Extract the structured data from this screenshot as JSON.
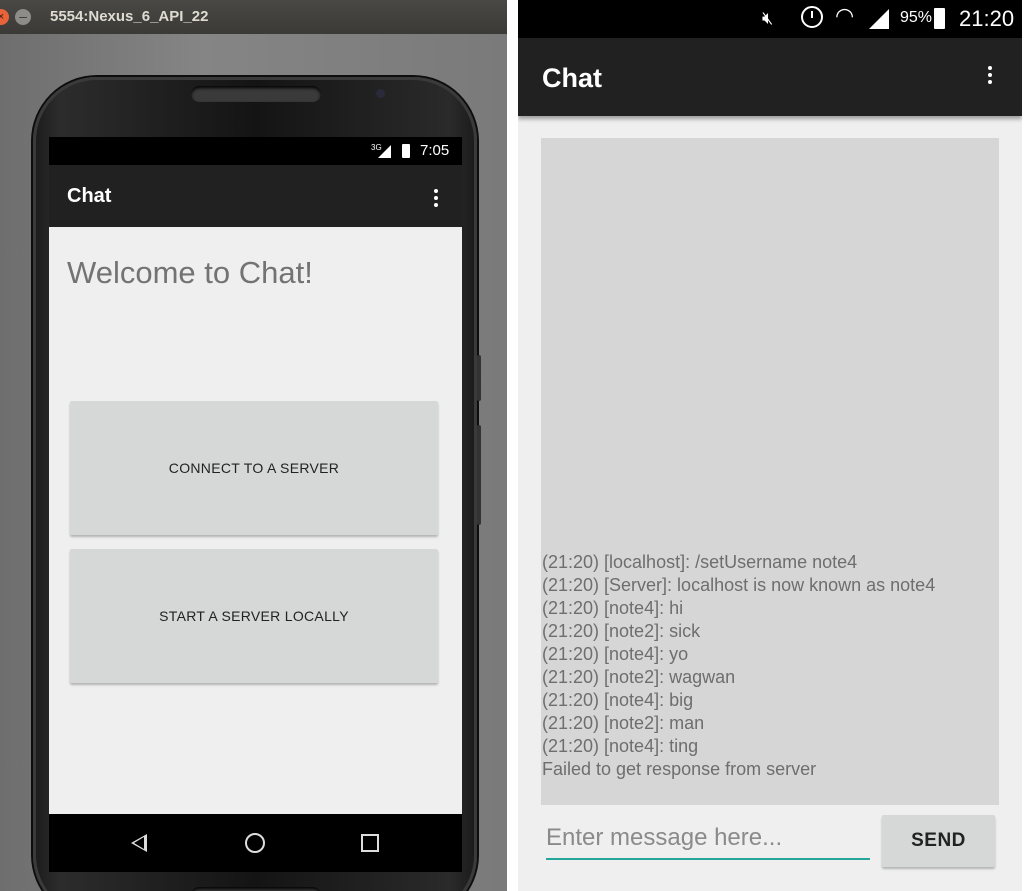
{
  "emulator": {
    "window_title": "5554:Nexus_6_API_22",
    "close_glyph": "×",
    "minimize_glyph": "–",
    "phone": {
      "status_bar": {
        "network": "3G",
        "time": "7:05"
      },
      "app_bar": {
        "title": "Chat",
        "menu_icon": "overflow-menu-icon"
      },
      "welcome_text": "Welcome to Chat!",
      "buttons": {
        "connect": "CONNECT TO A SERVER",
        "start_server": "START A SERVER LOCALLY"
      },
      "nav_bar": {
        "icons": [
          "back-icon",
          "home-icon",
          "recents-icon"
        ]
      }
    }
  },
  "device": {
    "status_bar": {
      "battery_percent": "95%",
      "time": "21:20",
      "icons": [
        "mute-icon",
        "alarm-icon",
        "wifi-icon",
        "signal-icon",
        "battery-icon"
      ]
    },
    "app_bar": {
      "title": "Chat",
      "menu_icon": "overflow-menu-icon"
    },
    "messages": [
      "(21:20) [localhost]: /setUsername note4",
      "(21:20) [Server]: localhost is now known as note4",
      "(21:20) [note4]: hi",
      "(21:20) [note2]: sick",
      "(21:20) [note4]: yo",
      "(21:20) [note2]: wagwan",
      "(21:20) [note4]: big",
      "(21:20) [note2]: man",
      "(21:20) [note4]: ting",
      "Failed to get response from server"
    ],
    "input": {
      "placeholder": "Enter message here...",
      "value": ""
    },
    "send_label": "SEND",
    "accent_color": "#26a69a"
  }
}
